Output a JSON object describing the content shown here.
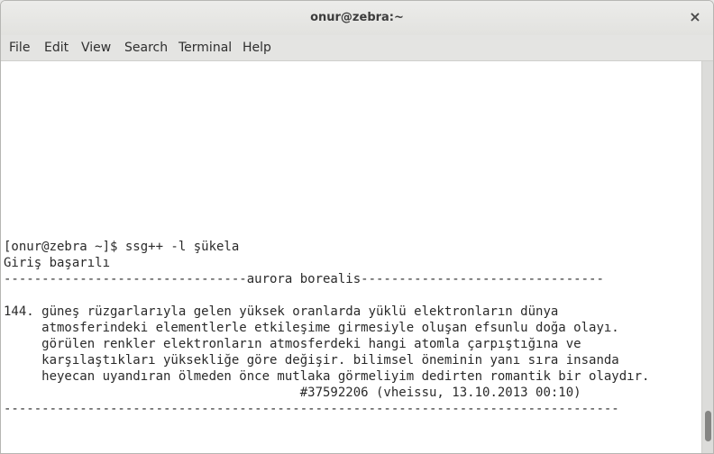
{
  "window": {
    "title": "onur@zebra:~",
    "close_glyph": "×"
  },
  "menubar": {
    "items": [
      "File",
      "Edit",
      "View",
      "Search",
      "Terminal",
      "Help"
    ]
  },
  "terminal": {
    "lines": [
      "[onur@zebra ~]$ ssg++ -l şükela",
      "Giriş başarılı",
      "--------------------------------aurora borealis--------------------------------",
      "",
      "144. güneş rüzgarlarıyla gelen yüksek oranlarda yüklü elektronların dünya",
      "     atmosferindeki elementlerle etkileşime girmesiyle oluşan efsunlu doğa olayı.",
      "     görülen renkler elektronların atmosferdeki hangi atomla çarpıştığına ve",
      "     karşılaştıkları yüksekliğe göre değişir. bilimsel öneminin yanı sıra insanda",
      "     heyecan uyandıran ölmeden önce mutlaka görmeliyim dedirten romantik bir olaydır.",
      "                                       #37592206 (vheissu, 13.10.2013 00:10)",
      "---------------------------------------------------------------------------------"
    ]
  }
}
